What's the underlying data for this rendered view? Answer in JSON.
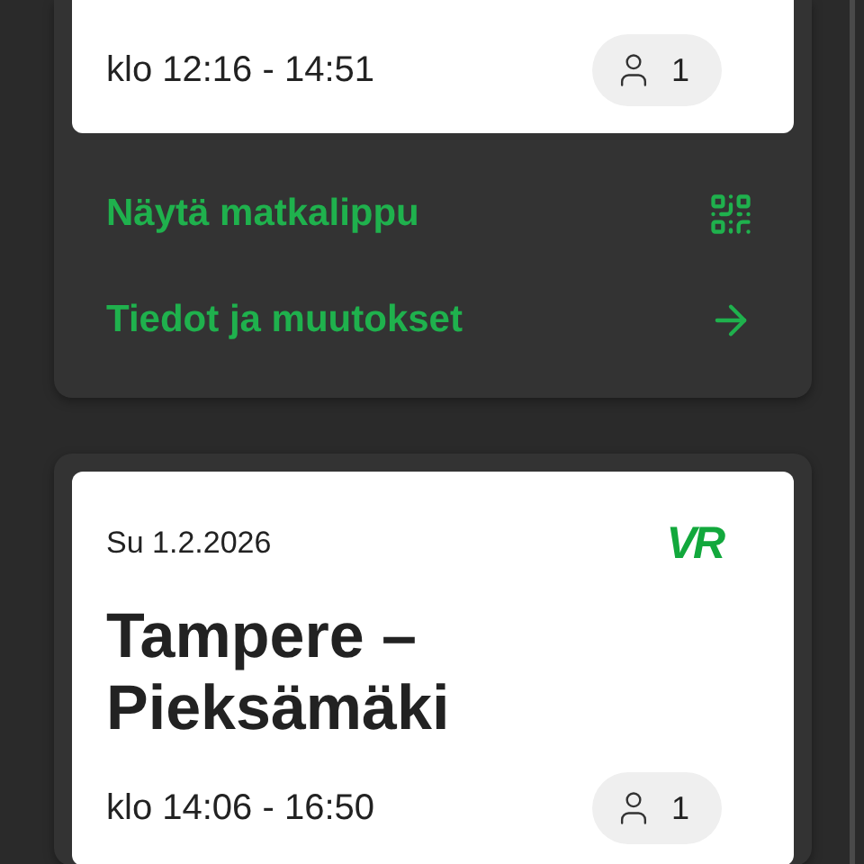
{
  "trips": [
    {
      "time": "klo 12:16 - 14:51",
      "passengers": "1",
      "actions": [
        {
          "label": "Näytä matkalippu",
          "kind": "qr"
        },
        {
          "label": "Tiedot ja muutokset",
          "kind": "arrow"
        }
      ]
    },
    {
      "date": "Su 1.2.2026",
      "logo": "VR",
      "title": "Tampere – Pieksämäki",
      "time": "klo 14:06 - 16:50",
      "passengers": "1"
    }
  ]
}
